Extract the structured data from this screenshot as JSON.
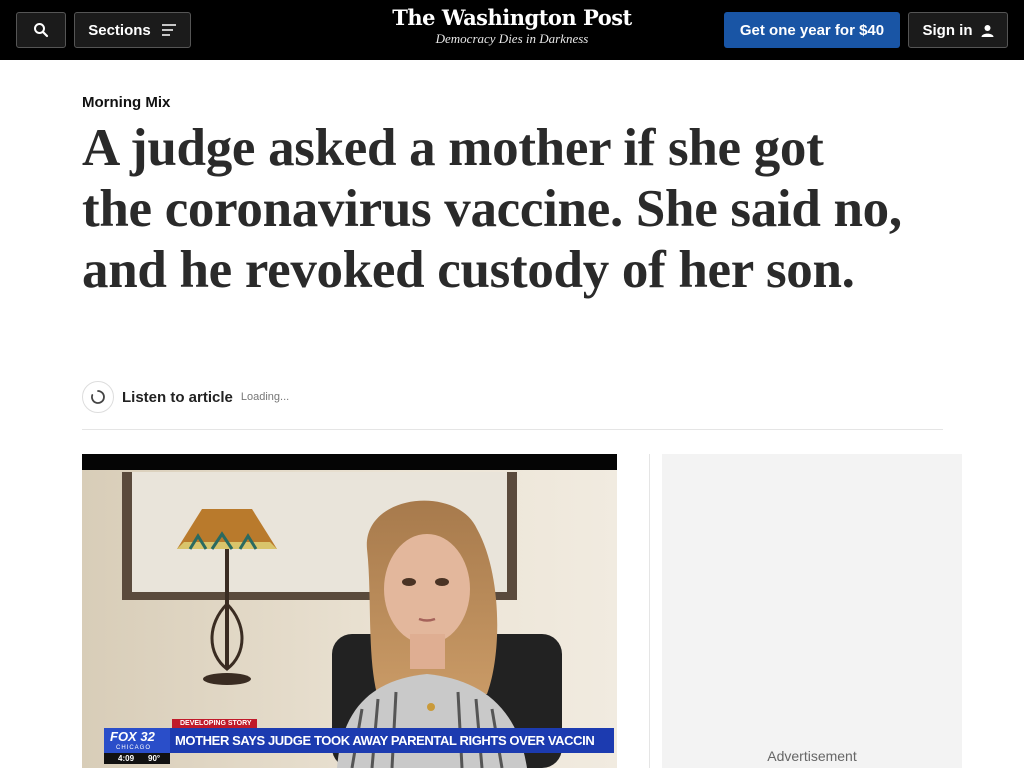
{
  "header": {
    "sections_label": "Sections",
    "logo_text": "The Washington Post",
    "tagline": "Democracy Dies in Darkness",
    "offer_label": "Get one year for $40",
    "signin_label": "Sign in"
  },
  "article": {
    "kicker": "Morning Mix",
    "headline": "A judge asked a mother if she got the coronavirus vaccine. She said no, and he revoked custody of her son.",
    "listen_label": "Listen to article",
    "listen_status": "Loading..."
  },
  "video": {
    "breaking_tag": "DEVELOPING STORY",
    "lower_third": "MOTHER SAYS JUDGE TOOK AWAY PARENTAL RIGHTS OVER VACCINE",
    "station": "FOX 32",
    "station_city": "CHICAGO",
    "clock": "4:09",
    "temperature": "90°"
  },
  "sidebar": {
    "ad_label": "Advertisement"
  },
  "colors": {
    "header_bg": "#000000",
    "accent_blue": "#1955a5",
    "headline": "#2a2a2a"
  },
  "icons": [
    "search-icon",
    "menu-icon",
    "user-icon",
    "loading-spinner-icon"
  ]
}
